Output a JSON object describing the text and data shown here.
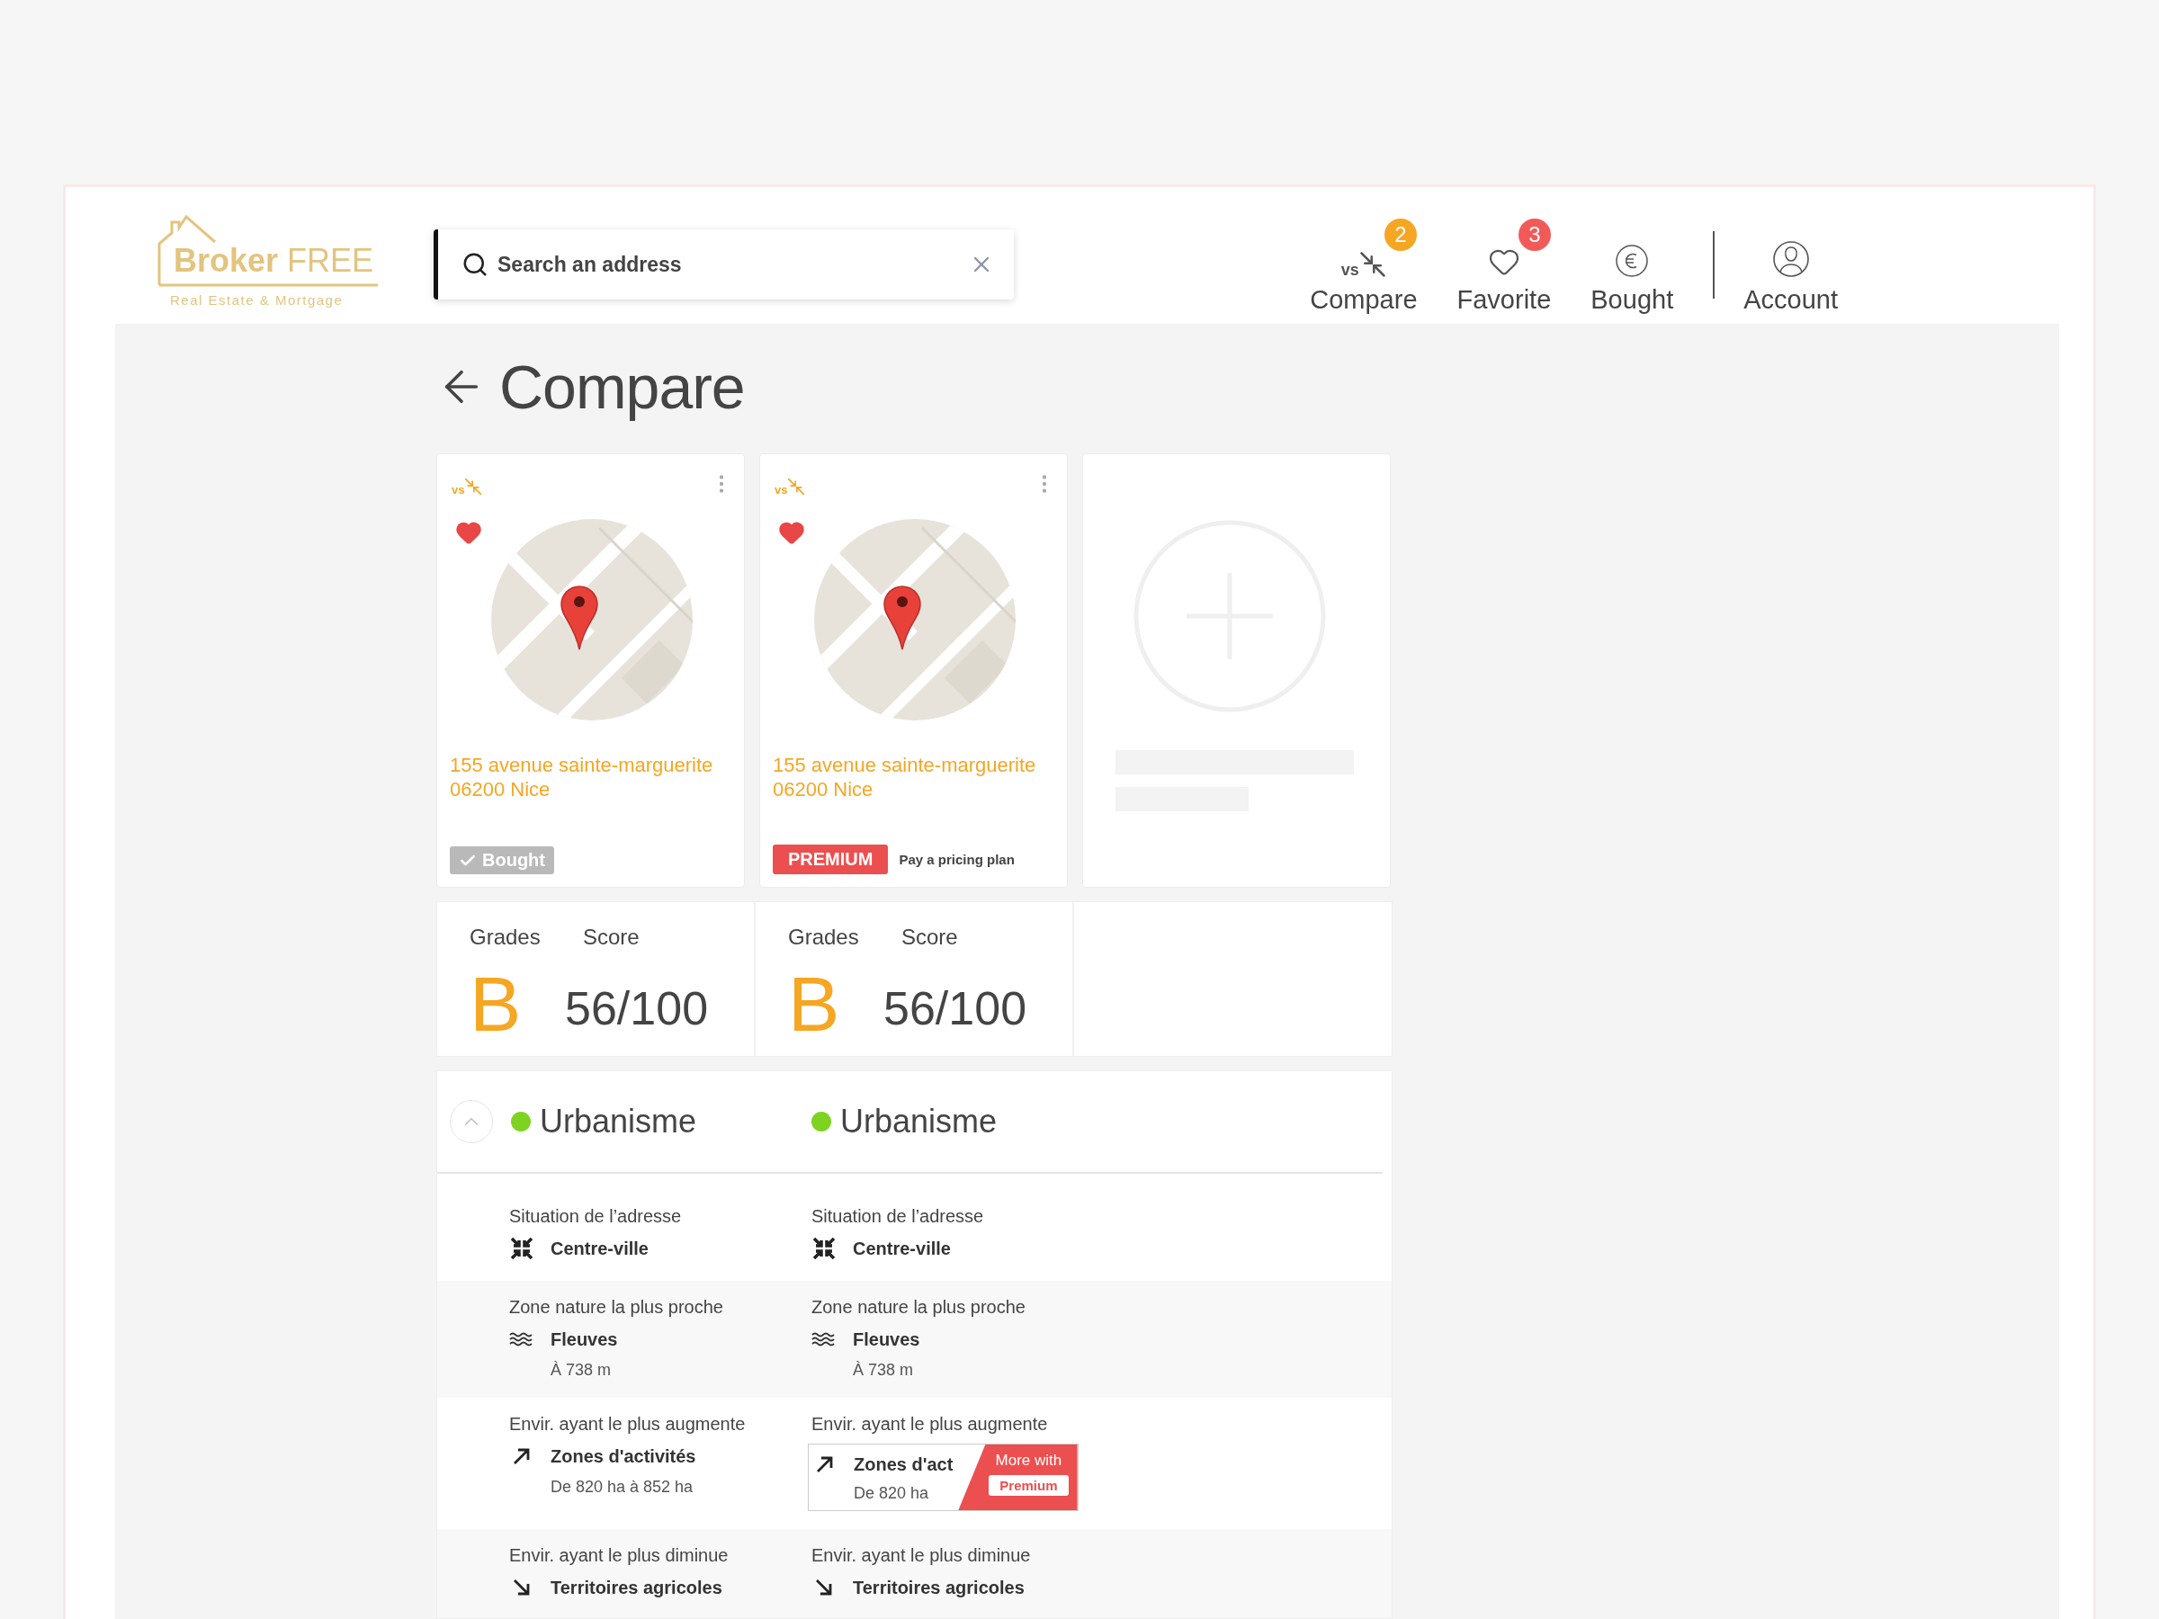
{
  "header": {
    "logo": {
      "name": "**Broker** FREE",
      "tagline": "Real Estate & Mortgage"
    },
    "search": {
      "value": "Search an address"
    },
    "nav": [
      {
        "kind": "compare",
        "icon_text": "vs",
        "label": "Compare",
        "badge": "2",
        "color": "#f5a623"
      },
      {
        "kind": "favorite",
        "label": "Favorite",
        "badge": "3",
        "color": "#f25a5a"
      },
      {
        "kind": "bought",
        "label": "Bought"
      }
    ],
    "account": {
      "label": "Account"
    }
  },
  "page": {
    "title": "Compare"
  },
  "cards": [
    {
      "kind": "property",
      "icon_text": "vs",
      "favorite": true,
      "address_line1": "155 avenue sainte-marguerite",
      "address_line2": "06200 Nice",
      "status": {
        "kind": "bought",
        "label": "Bought"
      }
    },
    {
      "kind": "property",
      "icon_text": "vs",
      "favorite": true,
      "address_line1": "155 avenue sainte-marguerite",
      "address_line2": "06200 Nice",
      "status": {
        "kind": "premium",
        "label": "PREMIUM",
        "note": "Pay a pricing plan"
      }
    },
    {
      "kind": "empty"
    }
  ],
  "grades": [
    {
      "grades_label": "Grades",
      "score_label": "Score",
      "grade": "B",
      "score": "56/100"
    },
    {
      "grades_label": "Grades",
      "score_label": "Score",
      "grade": "B",
      "score": "56/100"
    }
  ],
  "section": {
    "expanded": true,
    "columns": [
      {
        "title": "Urbanisme",
        "color": "#7ed321"
      },
      {
        "title": "Urbanisme",
        "color": "#7ed321"
      }
    ],
    "rows": [
      {
        "kind": "center",
        "cells": [
          {
            "label": "Situation de l’adresse",
            "value": "Centre-ville"
          },
          {
            "label": "Situation de l’adresse",
            "value": "Centre-ville"
          }
        ]
      },
      {
        "kind": "waves",
        "cells": [
          {
            "label": "Zone nature la plus proche",
            "value": "Fleuves",
            "sub": "À 738 m"
          },
          {
            "label": "Zone nature la plus proche",
            "value": "Fleuves",
            "sub": "À 738 m"
          }
        ]
      },
      {
        "kind": "up",
        "cells": [
          {
            "label": "Envir. ayant le plus augmente",
            "value": "Zones d'activités",
            "sub": "De 820 ha à 852 ha"
          },
          {
            "label": "Envir. ayant le plus augmente",
            "value": "Zones d'act",
            "sub": "De 820 ha",
            "locked": {
              "title": "More with",
              "button": "Premium"
            }
          }
        ]
      },
      {
        "kind": "down",
        "cells": [
          {
            "label": "Envir. ayant le plus diminue",
            "value": "Territoires agricoles"
          },
          {
            "label": "Envir. ayant le plus diminue",
            "value": "Territoires agricoles"
          }
        ]
      }
    ]
  }
}
